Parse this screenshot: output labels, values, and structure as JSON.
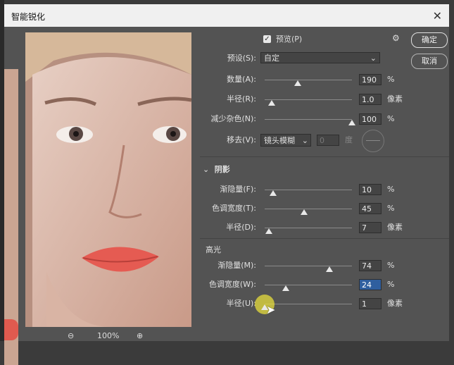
{
  "window": {
    "title": "智能锐化"
  },
  "buttons": {
    "ok": "确定",
    "cancel": "取消"
  },
  "preview_toggle": {
    "label": "预览(P)",
    "checked": true
  },
  "preset": {
    "label": "预设(S):",
    "value": "自定"
  },
  "sharpen": {
    "amount": {
      "label": "数量(A):",
      "value": "190",
      "unit": "%",
      "level": 0.38
    },
    "radius": {
      "label": "半径(R):",
      "value": "1.0",
      "unit": "像素",
      "level": 0.08
    },
    "noise": {
      "label": "减少杂色(N):",
      "value": "100",
      "unit": "%",
      "level": 1.0
    },
    "remove": {
      "label": "移去(V):",
      "value": "镜头模糊",
      "angle_value": "0",
      "angle_unit": "度"
    }
  },
  "shadows": {
    "header": "阴影",
    "fade": {
      "label": "渐隐量(F):",
      "value": "10",
      "unit": "%",
      "level": 0.1
    },
    "tonal_width": {
      "label": "色调宽度(T):",
      "value": "45",
      "unit": "%",
      "level": 0.45
    },
    "radius": {
      "label": "半径(D):",
      "value": "7",
      "unit": "像素",
      "level": 0.05
    }
  },
  "highlights": {
    "header": "高光",
    "fade": {
      "label": "渐隐量(M):",
      "value": "74",
      "unit": "%",
      "level": 0.74
    },
    "tonal_width": {
      "label": "色调宽度(W):",
      "value": "24",
      "unit": "%",
      "level": 0.24
    },
    "radius": {
      "label": "半径(U):",
      "value": "1",
      "unit": "像素",
      "level": 0.0
    }
  },
  "zoom": {
    "value": "100%"
  }
}
